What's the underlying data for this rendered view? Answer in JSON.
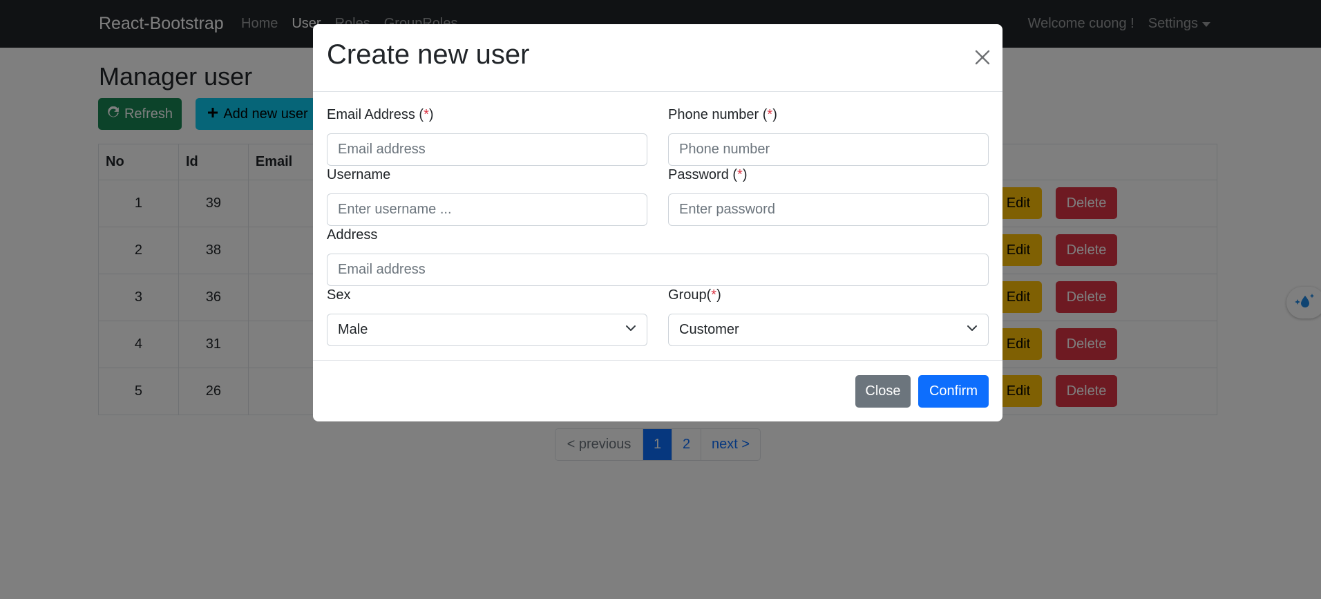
{
  "navbar": {
    "brand": "React-Bootstrap",
    "links": [
      "Home",
      "User",
      "Roles",
      "GroupRoles"
    ],
    "welcome": "Welcome cuong !",
    "settings": "Settings"
  },
  "page": {
    "title": "Manager user",
    "refresh_label": "Refresh",
    "add_label": "Add new user"
  },
  "table": {
    "headers": [
      "No",
      "Id",
      "Email"
    ],
    "rows": [
      {
        "no": "1",
        "id": "39"
      },
      {
        "no": "2",
        "id": "38"
      },
      {
        "no": "3",
        "id": "36"
      },
      {
        "no": "4",
        "id": "31"
      },
      {
        "no": "5",
        "id": "26"
      }
    ],
    "edit_label": "Edit",
    "delete_label": "Delete"
  },
  "pagination": {
    "prev": "< previous",
    "pages": [
      "1",
      "2"
    ],
    "next": "next >",
    "current": "1"
  },
  "modal": {
    "title": "Create new user",
    "email_label": "Email Address",
    "email_placeholder": "Email address",
    "phone_label": "Phone number",
    "phone_placeholder": "Phone number",
    "username_label": "Username",
    "username_placeholder": "Enter username ...",
    "password_label": "Password",
    "password_placeholder": "Enter password",
    "address_label": "Address",
    "address_placeholder": "Email address",
    "sex_label": "Sex",
    "sex_value": "Male",
    "group_label": "Group",
    "group_value": "Customer",
    "required_mark": "*",
    "close_label": "Close",
    "confirm_label": "Confirm"
  },
  "colors": {
    "navbar": "#212529",
    "success": "#198754",
    "info": "#0dcaf0",
    "warning": "#ffc107",
    "danger": "#dc3545",
    "primary": "#0d6efd",
    "secondary": "#6c757d"
  }
}
